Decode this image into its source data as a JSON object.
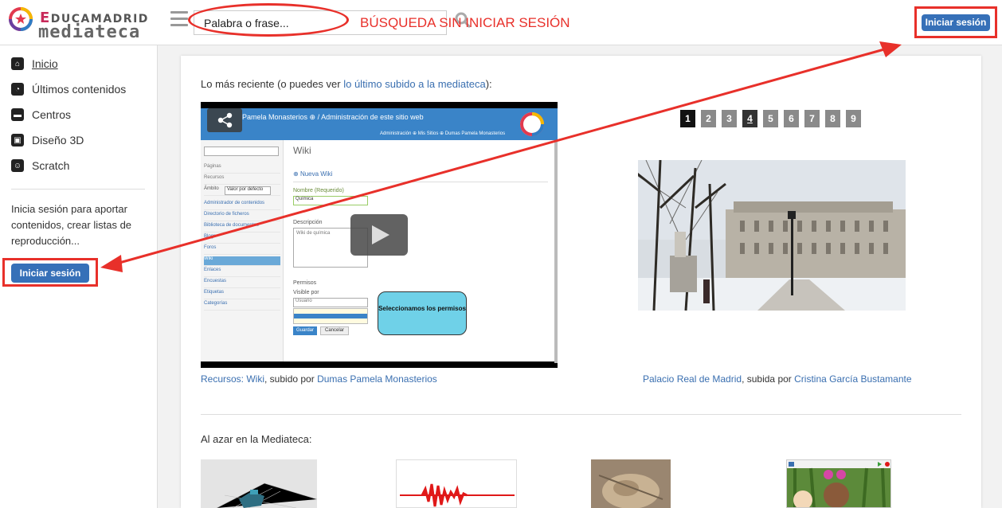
{
  "header": {
    "logo_educa": "EducaMadrid",
    "logo_media": "mediateca",
    "search_placeholder": "Palabra o frase...",
    "annotation": "BÚSQUEDA SIN INICIAR SESIÓN",
    "login_label": "Iniciar sesión"
  },
  "sidebar": {
    "items": [
      {
        "label": "Inicio",
        "icon": "home-icon"
      },
      {
        "label": "Últimos contenidos",
        "icon": "clock-icon"
      },
      {
        "label": "Centros",
        "icon": "folder-icon"
      },
      {
        "label": "Diseño 3D",
        "icon": "cube-icon"
      },
      {
        "label": "Scratch",
        "icon": "scratch-icon"
      }
    ],
    "info_text": "Inicia sesión para aportar contenidos, crear listas de reproducción...",
    "login_label": "Iniciar sesión"
  },
  "main": {
    "recent_prefix": "Lo más reciente (o puedes ver ",
    "recent_link": "lo último subido a la mediateca",
    "recent_suffix": "):",
    "video": {
      "bar_title": "Pamela Monasterios ⊕ / Administración de este sitio web",
      "bar_sub": "Administración ⊕     Mis Sitios ⊕     Dumas Pamela Monasterios",
      "page_title": "Wiki",
      "new_wiki": "Nueva Wiki",
      "name_label": "Nombre (Requerido)",
      "name_value": "Química",
      "desc_label": "Descripción",
      "desc_value": "Wiki de química",
      "perm_label": "Permisos",
      "visible_label": "Visible por",
      "select_value": "Usuario",
      "save": "Guardar",
      "cancel": "Cancelar",
      "tooltip": "Seleccionamos los permisos",
      "left_items": [
        "Páginas",
        "Recursos",
        "Ámbito",
        "Administrador de contenidos",
        "Directorio de ficheros",
        "Biblioteca de documentos",
        "Blogs",
        "Foros",
        "Wiki",
        "Enlaces",
        "Encuestas",
        "Etiquetas",
        "Categorías"
      ],
      "scope_value": "Valor por defecto"
    },
    "caption1": {
      "link1": "Recursos: Wiki",
      "mid": ", subido por ",
      "link2": "Dumas Pamela Monasterios"
    },
    "pager": [
      "1",
      "2",
      "3",
      "4",
      "5",
      "6",
      "7",
      "8",
      "9"
    ],
    "caption2": {
      "link1": "Palacio Real de Madrid",
      "mid": ", subida por ",
      "link2": "Cristina García Bustamante"
    },
    "random_title": "Al azar en la Mediateca:"
  },
  "colors": {
    "accent": "#3670b8",
    "annotation": "#e8302a"
  }
}
